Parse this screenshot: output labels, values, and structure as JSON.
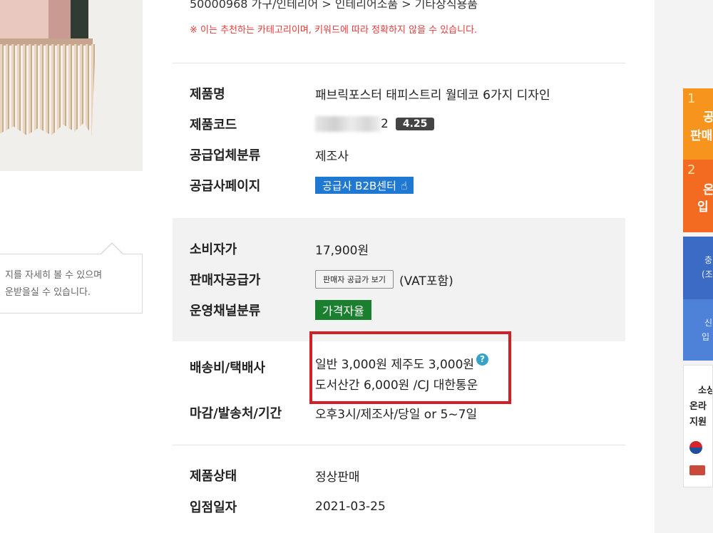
{
  "category": {
    "path": "50000968 가구/인테리어 > 인테리어소품 > 기타장식용품",
    "note": "※ 이는 추천하는 카테고리이며, 키워드에 따라 정확하지 않을 수 있습니다."
  },
  "tooltip": {
    "line1": "지를 자세히 볼 수 있으며",
    "line2": "운받을실 수 있습니다."
  },
  "product": {
    "name_label": "제품명",
    "name_value": "패브릭포스터 태피스트리 월데코 6가지 디자인",
    "code_label": "제품코드",
    "code_suffix": "2",
    "rating": "4.25",
    "supplier_type_label": "공급업체분류",
    "supplier_type_value": "제조사",
    "supplier_page_label": "공급사페이지",
    "supplier_page_button": "공급사 B2B센터"
  },
  "pricing": {
    "consumer_price_label": "소비자가",
    "consumer_price_value": "17,900원",
    "seller_price_label": "판매자공급가",
    "seller_price_button": "판매자 공급가 보기",
    "vat_note": "(VAT포함)",
    "channel_label": "운영채널분류",
    "channel_value": "가격자율"
  },
  "shipping": {
    "label": "배송비/택배사",
    "line1": "일반 3,000원 제주도 3,000원",
    "line2": "도서산간 6,000원 /CJ 대한통운",
    "help_icon": "?",
    "deadline_label": "마감/발송처/기간",
    "deadline_value": "오후3시/제조사/당일 or 5~7일"
  },
  "status": {
    "state_label": "제품상태",
    "state_value": "정상판매",
    "date_label": "입점일자",
    "date_value": "2021-03-25"
  },
  "sidebar": {
    "card1_num": "1",
    "card1_line1": "공",
    "card1_line2": "판매",
    "card2_num": "2",
    "card2_line1": "온",
    "card2_line2": "입",
    "card3_line1": "충",
    "card3_line2": "(조",
    "card4_line1": "신",
    "card4_line2": "입",
    "info_line1": "소상",
    "info_line2": "온라",
    "info_line3": "지원",
    "colors": {
      "orange": "#f7941d",
      "deep_orange": "#f26b21",
      "blue": "#3b6bc5",
      "light_blue": "#4e82d8"
    }
  },
  "colors": {
    "accent_red": "#d01f27",
    "link_blue": "#1f78d1",
    "green": "#1a7f2e",
    "note_red": "#e23b3b"
  }
}
